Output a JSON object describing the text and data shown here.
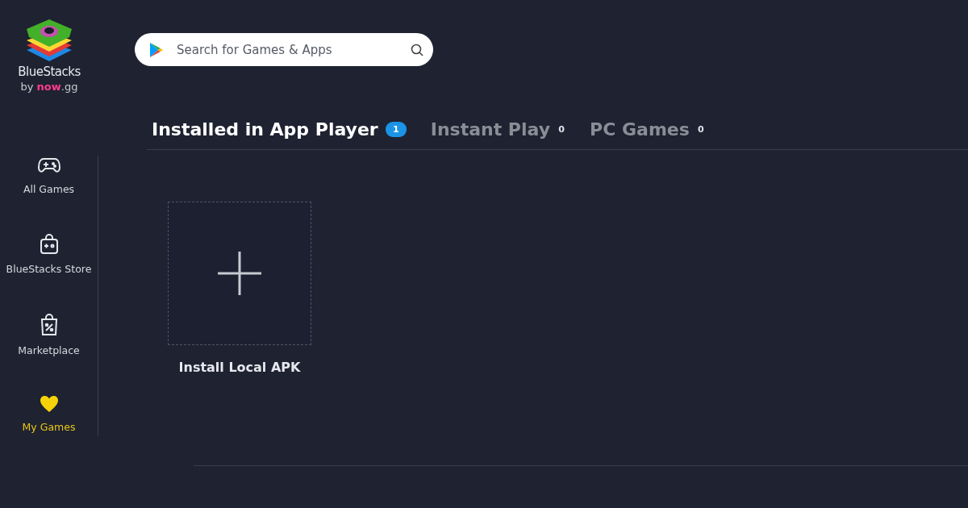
{
  "logo": {
    "name": "BlueStacks",
    "byline": "by **now**.gg"
  },
  "search": {
    "placeholder": "Search for Games & Apps"
  },
  "sidebar": {
    "items": [
      {
        "label": "All Games",
        "selected": false
      },
      {
        "label": "BlueStacks Store",
        "selected": false
      },
      {
        "label": "Marketplace",
        "selected": false
      },
      {
        "label": "My Games",
        "selected": true
      }
    ]
  },
  "tabs": [
    {
      "label": "Installed in App Player",
      "count": "1",
      "selected": true
    },
    {
      "label": "Instant Play",
      "count": "0",
      "selected": false
    },
    {
      "label": "PC Games",
      "count": "0",
      "selected": false
    }
  ],
  "apps": [
    {
      "label": "Install Local APK"
    }
  ]
}
